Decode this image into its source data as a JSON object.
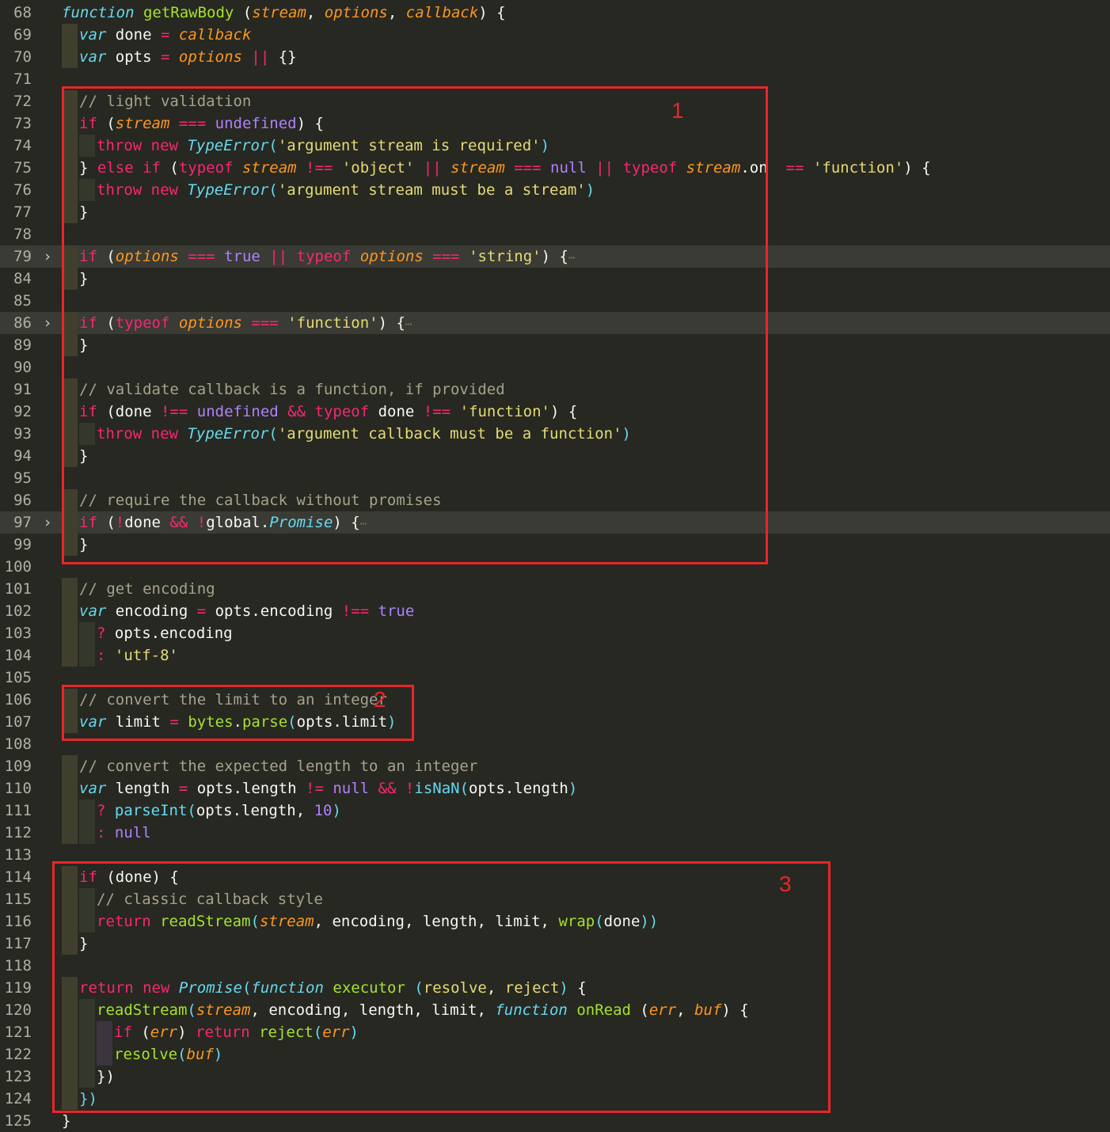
{
  "editor": {
    "lines": [
      {
        "n": "68",
        "g": 0,
        "segs": [
          [
            "t",
            "function"
          ],
          [
            "w",
            " "
          ],
          [
            "f",
            "getRawBody"
          ],
          [
            "w",
            " ("
          ],
          [
            "p",
            "stream"
          ],
          [
            "w",
            ", "
          ],
          [
            "p",
            "options"
          ],
          [
            "w",
            ", "
          ],
          [
            "p",
            "callback"
          ],
          [
            "w",
            ") {"
          ]
        ]
      },
      {
        "n": "69",
        "g": 1,
        "segs": [
          [
            "t",
            "var"
          ],
          [
            "w",
            " done "
          ],
          [
            "k",
            "="
          ],
          [
            "w",
            " "
          ],
          [
            "p",
            "callback"
          ]
        ]
      },
      {
        "n": "70",
        "g": 1,
        "segs": [
          [
            "t",
            "var"
          ],
          [
            "w",
            " opts "
          ],
          [
            "k",
            "="
          ],
          [
            "w",
            " "
          ],
          [
            "p",
            "options"
          ],
          [
            "w",
            " "
          ],
          [
            "k",
            "||"
          ],
          [
            "w",
            " {}"
          ]
        ]
      },
      {
        "n": "71",
        "g": 0,
        "segs": []
      },
      {
        "n": "72",
        "g": 1,
        "segs": [
          [
            "c",
            "// light validation"
          ]
        ]
      },
      {
        "n": "73",
        "g": 1,
        "segs": [
          [
            "k",
            "if"
          ],
          [
            "w",
            " ("
          ],
          [
            "p",
            "stream"
          ],
          [
            "w",
            " "
          ],
          [
            "k",
            "==="
          ],
          [
            "w",
            " "
          ],
          [
            "n",
            "undefined"
          ],
          [
            "w",
            ") {"
          ]
        ]
      },
      {
        "n": "74",
        "g": 2,
        "segs": [
          [
            "k",
            "throw"
          ],
          [
            "w",
            " "
          ],
          [
            "k",
            "new"
          ],
          [
            "w",
            " "
          ],
          [
            "t",
            "TypeError"
          ],
          [
            "b",
            "("
          ],
          [
            "s",
            "'argument stream is required'"
          ],
          [
            "b",
            ")"
          ]
        ]
      },
      {
        "n": "75",
        "g": 1,
        "segs": [
          [
            "w",
            "} "
          ],
          [
            "k",
            "else if"
          ],
          [
            "w",
            " ("
          ],
          [
            "k",
            "typeof"
          ],
          [
            "w",
            " "
          ],
          [
            "p",
            "stream"
          ],
          [
            "w",
            " "
          ],
          [
            "k",
            "!=="
          ],
          [
            "w",
            " "
          ],
          [
            "s",
            "'object'"
          ],
          [
            "w",
            " "
          ],
          [
            "k",
            "||"
          ],
          [
            "w",
            " "
          ],
          [
            "p",
            "stream"
          ],
          [
            "w",
            " "
          ],
          [
            "k",
            "==="
          ],
          [
            "w",
            " "
          ],
          [
            "n",
            "null"
          ],
          [
            "w",
            " "
          ],
          [
            "k",
            "||"
          ],
          [
            "w",
            " "
          ],
          [
            "k",
            "typeof"
          ],
          [
            "w",
            " "
          ],
          [
            "p",
            "stream"
          ],
          [
            "w",
            ".on  "
          ],
          [
            "k",
            "=="
          ],
          [
            "w",
            " "
          ],
          [
            "s",
            "'function'"
          ],
          [
            "w",
            ") {"
          ]
        ]
      },
      {
        "n": "76",
        "g": 2,
        "segs": [
          [
            "k",
            "throw"
          ],
          [
            "w",
            " "
          ],
          [
            "k",
            "new"
          ],
          [
            "w",
            " "
          ],
          [
            "t",
            "TypeError"
          ],
          [
            "b",
            "("
          ],
          [
            "s",
            "'argument stream must be a stream'"
          ],
          [
            "b",
            ")"
          ]
        ]
      },
      {
        "n": "77",
        "g": 1,
        "segs": [
          [
            "w",
            "}"
          ]
        ]
      },
      {
        "n": "78",
        "g": 0,
        "segs": []
      },
      {
        "n": "79",
        "g": 1,
        "fold": true,
        "hl": true,
        "segs": [
          [
            "k",
            "if"
          ],
          [
            "w",
            " ("
          ],
          [
            "p",
            "options"
          ],
          [
            "w",
            " "
          ],
          [
            "k",
            "==="
          ],
          [
            "w",
            " "
          ],
          [
            "n",
            "true"
          ],
          [
            "w",
            " "
          ],
          [
            "k",
            "||"
          ],
          [
            "w",
            " "
          ],
          [
            "k",
            "typeof"
          ],
          [
            "w",
            " "
          ],
          [
            "p",
            "options"
          ],
          [
            "w",
            " "
          ],
          [
            "k",
            "==="
          ],
          [
            "w",
            " "
          ],
          [
            "s",
            "'string'"
          ],
          [
            "w",
            ") {"
          ],
          [
            "e",
            "⋯"
          ]
        ]
      },
      {
        "n": "84",
        "g": 1,
        "segs": [
          [
            "w",
            "}"
          ]
        ]
      },
      {
        "n": "85",
        "g": 0,
        "segs": []
      },
      {
        "n": "86",
        "g": 1,
        "fold": true,
        "hl": true,
        "segs": [
          [
            "k",
            "if"
          ],
          [
            "w",
            " ("
          ],
          [
            "k",
            "typeof"
          ],
          [
            "w",
            " "
          ],
          [
            "p",
            "options"
          ],
          [
            "w",
            " "
          ],
          [
            "k",
            "==="
          ],
          [
            "w",
            " "
          ],
          [
            "s",
            "'function'"
          ],
          [
            "w",
            ") {"
          ],
          [
            "e",
            "⋯"
          ]
        ]
      },
      {
        "n": "89",
        "g": 1,
        "segs": [
          [
            "w",
            "}"
          ]
        ]
      },
      {
        "n": "90",
        "g": 0,
        "segs": []
      },
      {
        "n": "91",
        "g": 1,
        "segs": [
          [
            "c",
            "// validate callback is a function, if provided"
          ]
        ]
      },
      {
        "n": "92",
        "g": 1,
        "segs": [
          [
            "k",
            "if"
          ],
          [
            "w",
            " (done "
          ],
          [
            "k",
            "!=="
          ],
          [
            "w",
            " "
          ],
          [
            "n",
            "undefined"
          ],
          [
            "w",
            " "
          ],
          [
            "k",
            "&&"
          ],
          [
            "w",
            " "
          ],
          [
            "k",
            "typeof"
          ],
          [
            "w",
            " done "
          ],
          [
            "k",
            "!=="
          ],
          [
            "w",
            " "
          ],
          [
            "s",
            "'function'"
          ],
          [
            "w",
            ") {"
          ]
        ]
      },
      {
        "n": "93",
        "g": 2,
        "segs": [
          [
            "k",
            "throw"
          ],
          [
            "w",
            " "
          ],
          [
            "k",
            "new"
          ],
          [
            "w",
            " "
          ],
          [
            "t",
            "TypeError"
          ],
          [
            "b",
            "("
          ],
          [
            "s",
            "'argument callback must be a function'"
          ],
          [
            "b",
            ")"
          ]
        ]
      },
      {
        "n": "94",
        "g": 1,
        "segs": [
          [
            "w",
            "}"
          ]
        ]
      },
      {
        "n": "95",
        "g": 0,
        "segs": []
      },
      {
        "n": "96",
        "g": 1,
        "segs": [
          [
            "c",
            "// require the callback without promises"
          ]
        ]
      },
      {
        "n": "97",
        "g": 1,
        "fold": true,
        "hl": true,
        "segs": [
          [
            "k",
            "if"
          ],
          [
            "w",
            " ("
          ],
          [
            "k",
            "!"
          ],
          [
            "w",
            "done "
          ],
          [
            "k",
            "&&"
          ],
          [
            "w",
            " "
          ],
          [
            "k",
            "!"
          ],
          [
            "w",
            "global."
          ],
          [
            "t",
            "Promise"
          ],
          [
            "w",
            ") {"
          ],
          [
            "e",
            "⋯"
          ]
        ]
      },
      {
        "n": "99",
        "g": 1,
        "segs": [
          [
            "w",
            "}"
          ]
        ]
      },
      {
        "n": "100",
        "g": 0,
        "segs": []
      },
      {
        "n": "101",
        "g": 1,
        "segs": [
          [
            "c",
            "// get encoding"
          ]
        ]
      },
      {
        "n": "102",
        "g": 1,
        "segs": [
          [
            "t",
            "var"
          ],
          [
            "w",
            " encoding "
          ],
          [
            "k",
            "="
          ],
          [
            "w",
            " opts.encoding "
          ],
          [
            "k",
            "!=="
          ],
          [
            "w",
            " "
          ],
          [
            "n",
            "true"
          ]
        ]
      },
      {
        "n": "103",
        "g": 2,
        "segs": [
          [
            "k",
            "?"
          ],
          [
            "w",
            " opts.encoding"
          ]
        ]
      },
      {
        "n": "104",
        "g": 2,
        "segs": [
          [
            "k",
            ":"
          ],
          [
            "w",
            " "
          ],
          [
            "s",
            "'utf-8'"
          ]
        ]
      },
      {
        "n": "105",
        "g": 0,
        "segs": []
      },
      {
        "n": "106",
        "g": 1,
        "segs": [
          [
            "c",
            "// convert the limit to an integer"
          ]
        ]
      },
      {
        "n": "107",
        "g": 1,
        "segs": [
          [
            "t",
            "var"
          ],
          [
            "w",
            " limit "
          ],
          [
            "k",
            "="
          ],
          [
            "w",
            " "
          ],
          [
            "f",
            "bytes"
          ],
          [
            "w",
            "."
          ],
          [
            "f",
            "parse"
          ],
          [
            "b",
            "("
          ],
          [
            "w",
            "opts.limit"
          ],
          [
            "b",
            ")"
          ]
        ]
      },
      {
        "n": "108",
        "g": 0,
        "segs": []
      },
      {
        "n": "109",
        "g": 1,
        "segs": [
          [
            "c",
            "// convert the expected length to an integer"
          ]
        ]
      },
      {
        "n": "110",
        "g": 1,
        "segs": [
          [
            "t",
            "var"
          ],
          [
            "w",
            " length "
          ],
          [
            "k",
            "="
          ],
          [
            "w",
            " opts.length "
          ],
          [
            "k",
            "!="
          ],
          [
            "w",
            " "
          ],
          [
            "n",
            "null"
          ],
          [
            "w",
            " "
          ],
          [
            "k",
            "&&"
          ],
          [
            "w",
            " "
          ],
          [
            "k",
            "!"
          ],
          [
            "b",
            "isNaN("
          ],
          [
            "w",
            "opts.length"
          ],
          [
            "b",
            ")"
          ]
        ]
      },
      {
        "n": "111",
        "g": 2,
        "segs": [
          [
            "k",
            "?"
          ],
          [
            "w",
            " "
          ],
          [
            "b",
            "parseInt("
          ],
          [
            "w",
            "opts.length, "
          ],
          [
            "n",
            "10"
          ],
          [
            "b",
            ")"
          ]
        ]
      },
      {
        "n": "112",
        "g": 2,
        "segs": [
          [
            "k",
            ":"
          ],
          [
            "w",
            " "
          ],
          [
            "n",
            "null"
          ]
        ]
      },
      {
        "n": "113",
        "g": 0,
        "segs": []
      },
      {
        "n": "114",
        "g": 1,
        "segs": [
          [
            "k",
            "if"
          ],
          [
            "w",
            " (done) {"
          ]
        ]
      },
      {
        "n": "115",
        "g": 2,
        "segs": [
          [
            "c",
            "// classic callback style"
          ]
        ]
      },
      {
        "n": "116",
        "g": 2,
        "segs": [
          [
            "k",
            "return"
          ],
          [
            "w",
            " "
          ],
          [
            "f",
            "readStream"
          ],
          [
            "b",
            "("
          ],
          [
            "p",
            "stream"
          ],
          [
            "w",
            ", encoding, length, limit, "
          ],
          [
            "f",
            "wrap"
          ],
          [
            "b",
            "("
          ],
          [
            "w",
            "done"
          ],
          [
            "b",
            "))"
          ]
        ]
      },
      {
        "n": "117",
        "g": 1,
        "segs": [
          [
            "w",
            "}"
          ]
        ]
      },
      {
        "n": "118",
        "g": 0,
        "segs": []
      },
      {
        "n": "119",
        "g": 1,
        "segs": [
          [
            "k",
            "return"
          ],
          [
            "w",
            " "
          ],
          [
            "k",
            "new"
          ],
          [
            "w",
            " "
          ],
          [
            "t",
            "Promise"
          ],
          [
            "b",
            "("
          ],
          [
            "t",
            "function"
          ],
          [
            "w",
            " "
          ],
          [
            "f",
            "executor"
          ],
          [
            "w",
            " "
          ],
          [
            "b",
            "("
          ],
          [
            "m",
            "resolve"
          ],
          [
            "w",
            ", "
          ],
          [
            "m",
            "reject"
          ],
          [
            "b",
            ")"
          ],
          [
            "w",
            " {"
          ]
        ]
      },
      {
        "n": "120",
        "g": 2,
        "segs": [
          [
            "f",
            "readStream"
          ],
          [
            "b",
            "("
          ],
          [
            "p",
            "stream"
          ],
          [
            "w",
            ", encoding, length, limit, "
          ],
          [
            "t",
            "function"
          ],
          [
            "w",
            " "
          ],
          [
            "f",
            "onRead"
          ],
          [
            "w",
            " ("
          ],
          [
            "p",
            "err"
          ],
          [
            "w",
            ", "
          ],
          [
            "p",
            "buf"
          ],
          [
            "w",
            ") {"
          ]
        ]
      },
      {
        "n": "121",
        "g": 3,
        "segs": [
          [
            "k",
            "if"
          ],
          [
            "w",
            " ("
          ],
          [
            "p",
            "err"
          ],
          [
            "w",
            ") "
          ],
          [
            "k",
            "return"
          ],
          [
            "w",
            " "
          ],
          [
            "f",
            "reject"
          ],
          [
            "b",
            "("
          ],
          [
            "p",
            "err"
          ],
          [
            "b",
            ")"
          ]
        ]
      },
      {
        "n": "122",
        "g": 3,
        "segs": [
          [
            "f",
            "resolve"
          ],
          [
            "b",
            "("
          ],
          [
            "p",
            "buf"
          ],
          [
            "b",
            ")"
          ]
        ]
      },
      {
        "n": "123",
        "g": 2,
        "segs": [
          [
            "w",
            "})"
          ]
        ]
      },
      {
        "n": "124",
        "g": 1,
        "segs": [
          [
            "b",
            "})"
          ]
        ]
      },
      {
        "n": "125",
        "g": 0,
        "segs": [
          [
            "w",
            "}"
          ]
        ]
      }
    ]
  },
  "annotations": [
    {
      "label": "1"
    },
    {
      "label": "2"
    },
    {
      "label": "3"
    }
  ]
}
